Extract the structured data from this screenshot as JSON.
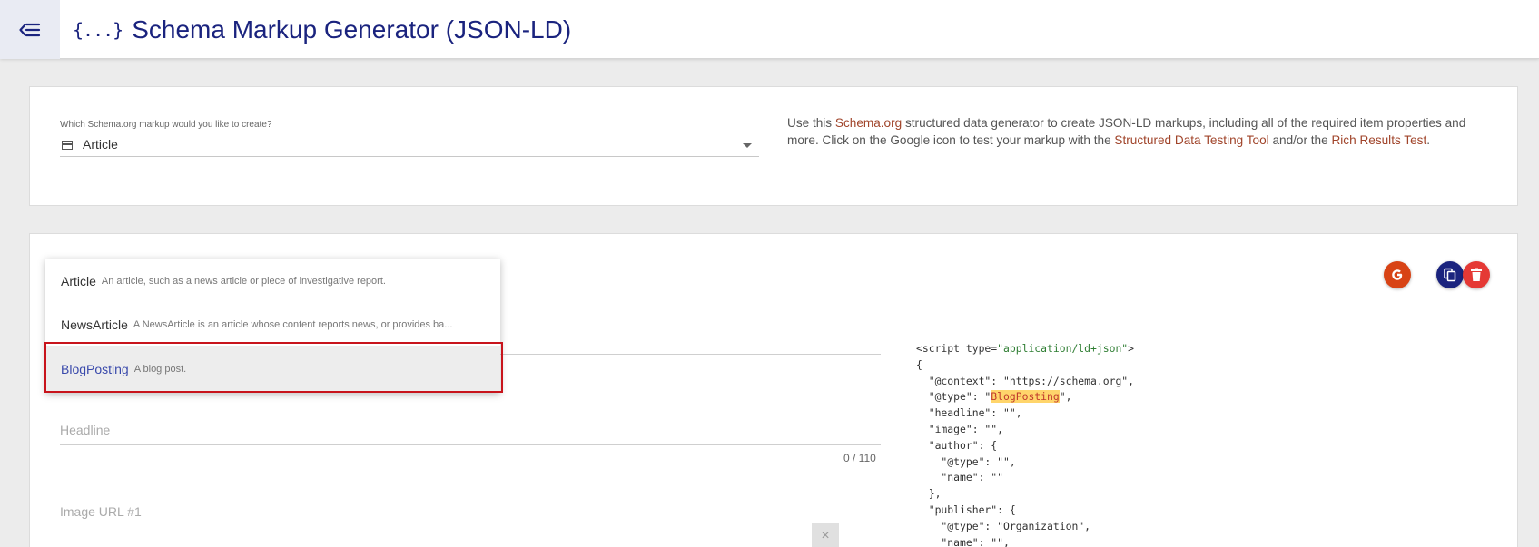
{
  "header": {
    "menu_icon": "menu-back-arrow-icon",
    "title_icon": "{...}",
    "title": "Schema Markup Generator (JSON-LD)"
  },
  "selector": {
    "label": "Which Schema.org markup would you like to create?",
    "value": "Article",
    "icon": "list-card-icon"
  },
  "description": {
    "t1": "Use this ",
    "link1": "Schema.org",
    "t2": " structured data generator to create JSON-LD markups, including all of the required item properties and more. Click on the Google icon to test your markup with the ",
    "link2": "Structured Data Testing Tool",
    "t3": " and/or the ",
    "link3": "Rich Results Test",
    "t4": "."
  },
  "actions": {
    "google": {
      "label": "G",
      "icon": "google-icon",
      "color": "#d84315"
    },
    "copy": {
      "icon": "copy-icon",
      "color": "#1a237e"
    },
    "delete": {
      "icon": "trash-icon",
      "color": "#e53935"
    }
  },
  "dropdown": {
    "options": [
      {
        "name": "Article",
        "desc": "An article, such as a news article or piece of investigative report."
      },
      {
        "name": "NewsArticle",
        "desc": "A NewsArticle is an article whose content reports news, or provides ba..."
      },
      {
        "name": "BlogPosting",
        "desc": "A blog post.",
        "selected": true
      }
    ]
  },
  "fields": {
    "headline_placeholder": "Headline",
    "headline_counter": "0 / 110",
    "image_placeholder": "Image URL #1",
    "clear_label": "×"
  },
  "code": {
    "l1a": "<script type=",
    "l1b": "\"application/ld+json\"",
    "l1c": ">",
    "l2": "{",
    "l3": "  \"@context\": \"https://schema.org\",",
    "l4a": "  \"@type\": \"",
    "l4b": "BlogPosting",
    "l4c": "\",",
    "l5": "  \"headline\": \"\",",
    "l6": "  \"image\": \"\",",
    "l7": "  \"author\": {",
    "l8": "    \"@type\": \"\",",
    "l9": "    \"name\": \"\"",
    "l10": "  },",
    "l11": "  \"publisher\": {",
    "l12": "    \"@type\": \"Organization\",",
    "l13": "    \"name\": \"\","
  }
}
